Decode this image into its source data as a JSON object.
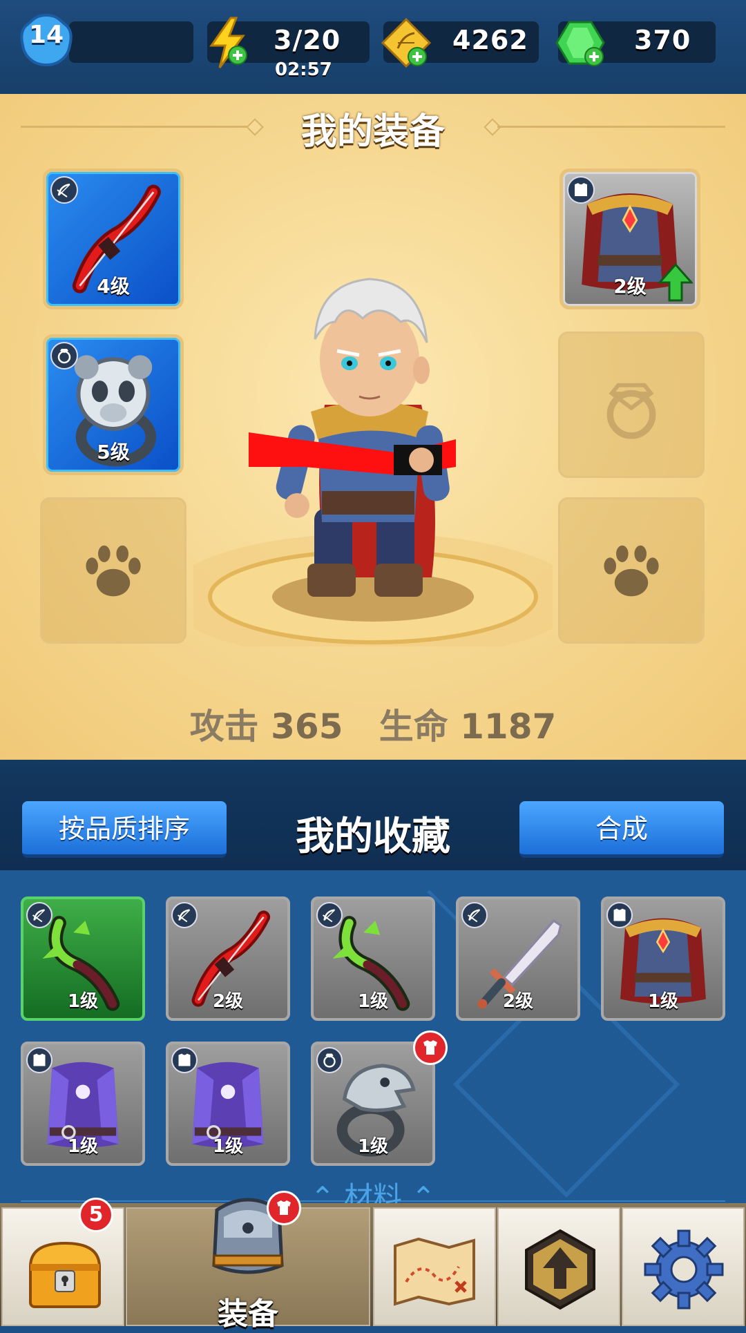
{
  "topbar": {
    "player_level": "14",
    "energy": "3/20",
    "energy_timer": "02:57",
    "gold": "4262",
    "gems": "370"
  },
  "equipment": {
    "title": "我的装备",
    "slots": [
      {
        "item": "red-bow",
        "level": "4级"
      },
      {
        "item": "panda-ring",
        "level": "5级"
      },
      {
        "item": "pet-empty"
      },
      {
        "item": "red-cape-armor",
        "level": "2级",
        "upgrade_available": true
      },
      {
        "item": "ring-empty"
      },
      {
        "item": "pet-empty"
      }
    ],
    "stats": {
      "attack_label": "攻击",
      "attack_value": "365",
      "hp_label": "生命",
      "hp_value": "1187"
    }
  },
  "collection": {
    "sort_button": "按品质排序",
    "title": "我的收藏",
    "merge_button": "合成",
    "items": [
      {
        "item": "green-scythe-bow",
        "level": "1级",
        "rarity": "green"
      },
      {
        "item": "red-bow",
        "level": "2级",
        "rarity": "grey"
      },
      {
        "item": "green-scythe-bow",
        "level": "1级",
        "rarity": "grey"
      },
      {
        "item": "serrated-sword",
        "level": "2级",
        "rarity": "grey"
      },
      {
        "item": "red-cape-armor",
        "level": "1级",
        "rarity": "grey"
      },
      {
        "item": "purple-vest",
        "level": "1级",
        "rarity": "grey"
      },
      {
        "item": "purple-vest",
        "level": "1级",
        "rarity": "grey"
      },
      {
        "item": "eagle-ring",
        "level": "1级",
        "rarity": "grey",
        "new": true
      }
    ],
    "materials_label": "材料"
  },
  "nav": {
    "chest_badge": "5",
    "equip_label": "装备",
    "tabs": [
      "chest",
      "equipment",
      "map",
      "upgrade",
      "settings"
    ]
  },
  "colors": {
    "panel_gold": "#f6d994",
    "blue_slot": "#2b8df0",
    "green_rarity": "#3fae48",
    "button_blue": "#2b86ec",
    "badge_red": "#e0262a"
  }
}
